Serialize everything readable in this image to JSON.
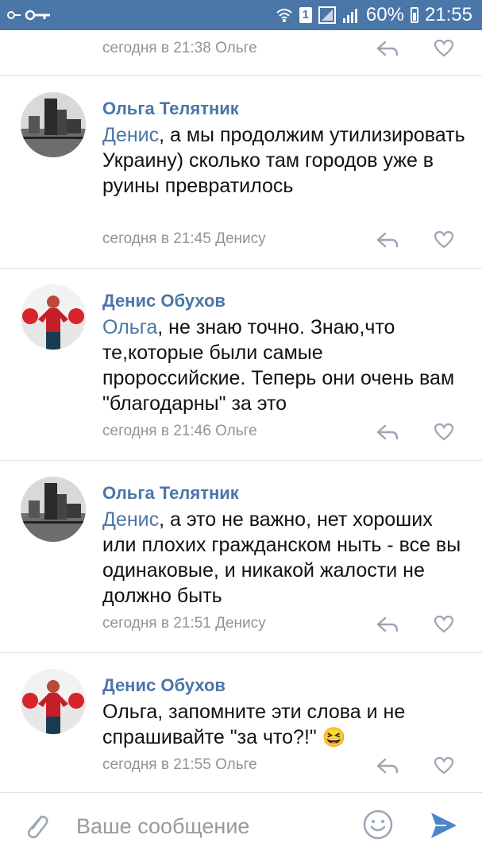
{
  "status_bar": {
    "battery": "60%",
    "time": "21:55",
    "sim_badge": "1"
  },
  "comments": [
    {
      "author": "",
      "mention": "",
      "text": "",
      "meta": "сегодня в 21:38 Ольге"
    },
    {
      "author": "Ольга Телятник",
      "mention": "Денис",
      "text": ", а мы продолжим утилизировать Украину) сколько там городов уже в руины превратилось",
      "meta": "сегодня в 21:45 Денису"
    },
    {
      "author": "Денис Обухов",
      "mention": "Ольга",
      "text": ", не знаю точно. Знаю,что те,которые были самые пророссийские. Теперь они очень вам \"благодарны\" за это",
      "meta": "сегодня в 21:46 Ольге"
    },
    {
      "author": "Ольга Телятник",
      "mention": "Денис",
      "text": ", а это не важно, нет хороших или плохих гражданском ныть - все вы одинаковые, и никакой жалости не должно быть",
      "meta": "сегодня в 21:51 Денису"
    },
    {
      "author": "Денис Обухов",
      "mention": "",
      "text": "Ольга, запомните эти слова и не спрашивайте \"за что?!\"",
      "emoji": "😆",
      "meta": "сегодня в 21:55 Ольге"
    }
  ],
  "composer": {
    "placeholder": "Ваше сообщение"
  },
  "icons": {
    "reply": "reply-icon",
    "like": "heart-icon",
    "attach": "paperclip-icon",
    "emoji": "smiley-icon",
    "send": "send-icon"
  },
  "colors": {
    "status_bar": "#4a76a8",
    "link": "#4a76a8",
    "meta": "#939393"
  }
}
